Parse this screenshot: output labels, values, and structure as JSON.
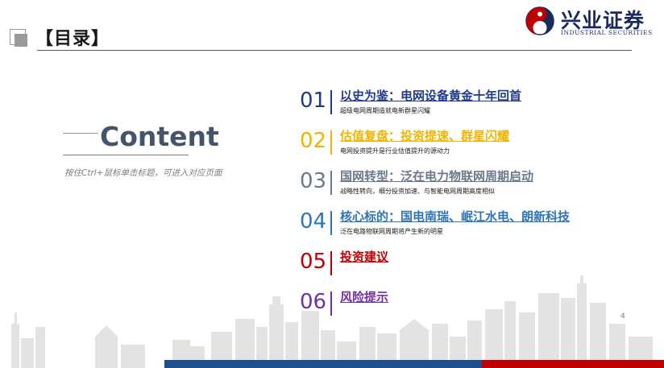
{
  "header": {
    "title": "【目录】",
    "logo_cn": "兴业证券",
    "logo_en": "INDUSTRIAL SECURITIES"
  },
  "content": {
    "heading": "Content",
    "hint": "按住Ctrl+鼠标单击标题，可进入对应页面"
  },
  "toc": [
    {
      "num": "01",
      "title": "以史为鉴：电网设备黄金十年回首",
      "subtitle": "超级电网周期造就电新群星闪耀",
      "color": "#1f3a8a"
    },
    {
      "num": "02",
      "title": "估值复盘：投资提速、群星闪耀",
      "subtitle": "电网投资提升是行业估值提升的源动力",
      "color": "#f0b400"
    },
    {
      "num": "03",
      "title": "国网转型：泛在电力物联网周期启动",
      "subtitle": "战略性转向，细分投资加速、与智能电网周期高度相似",
      "color": "#6b7a8a"
    },
    {
      "num": "04",
      "title": "核心标的：国电南瑞、岷江水电、朗新科技",
      "subtitle": "泛在电路物联网周期将产生新的明星",
      "color": "#2e75b6"
    },
    {
      "num": "05",
      "title": "投资建议",
      "subtitle": "",
      "color": "#c00000"
    },
    {
      "num": "06",
      "title": "风险提示",
      "subtitle": "",
      "color": "#7030a0"
    }
  ],
  "footer": {
    "page_number": "4"
  },
  "colors": {
    "blue_bar": "#1f4e8c",
    "red_bar": "#c00000",
    "skyline": "#d9d9d9"
  }
}
